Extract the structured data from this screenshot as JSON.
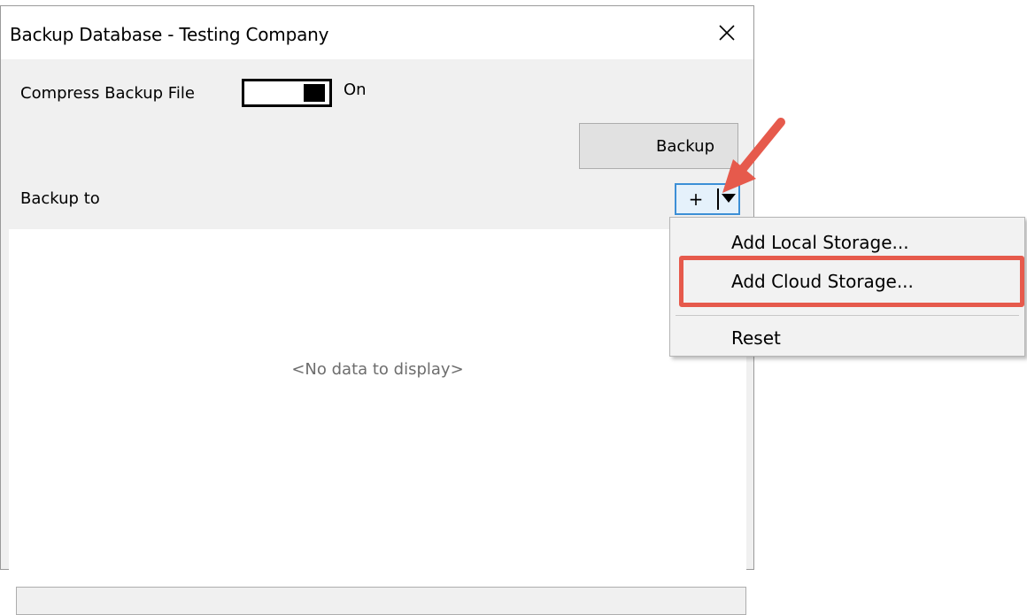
{
  "window": {
    "title": "Backup Database - Testing Company",
    "close_icon": "close-icon"
  },
  "options": {
    "compress_label": "Compress Backup File",
    "compress_state": "On",
    "backup_button": "Backup",
    "backup_to_label": "Backup to"
  },
  "add_button": {
    "plus_label": "+",
    "dropdown_icon": "chevron-down-icon"
  },
  "list": {
    "empty_text": "<No data to display>"
  },
  "menu": {
    "items": [
      {
        "label": "Add Local Storage..."
      },
      {
        "label": "Add Cloud Storage..."
      },
      {
        "label": "Reset"
      }
    ]
  },
  "colors": {
    "annotation": "#e65a4c",
    "focus_border": "#3c8fd6",
    "dialog_bg": "#f0f0f0"
  }
}
